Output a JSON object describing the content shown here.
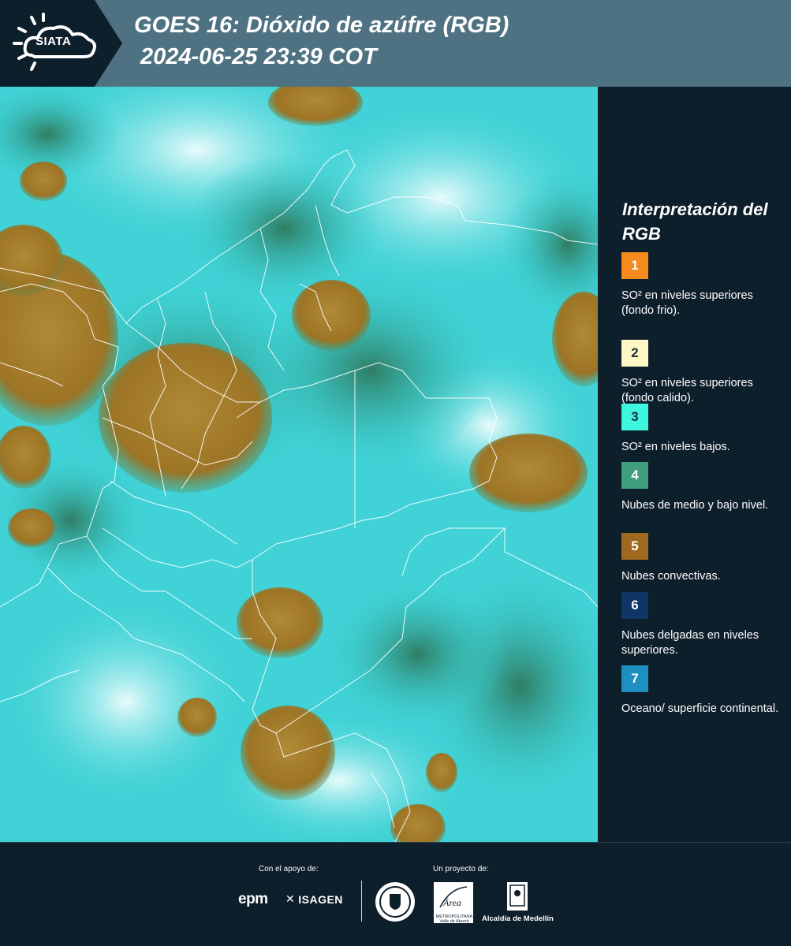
{
  "header": {
    "logo_text": "SIATA",
    "title_line1": "GOES 16: Dióxido de azúfre (RGB)",
    "title_line2": "2024-06-25 23:39 COT"
  },
  "legend": {
    "title": "Interpretación del RGB",
    "items": [
      {
        "number": "1",
        "color": "#f78a1c",
        "text_color": "#ffffff",
        "description": "SO² en niveles superiores (fondo frio)."
      },
      {
        "number": "2",
        "color": "#fdf7c4",
        "text_color": "#1d2d3a",
        "description": "SO² en niveles superiores (fondo calido)."
      },
      {
        "number": "3",
        "color": "#3ef5dd",
        "text_color": "#1d2d3a",
        "description": "SO² en niveles bajos."
      },
      {
        "number": "4",
        "color": "#3f9e7e",
        "text_color": "#ffffff",
        "description": "Nubes de medio y bajo nivel."
      },
      {
        "number": "5",
        "color": "#9f6a1f",
        "text_color": "#ffffff",
        "description": "Nubes convectivas."
      },
      {
        "number": "6",
        "color": "#0f3566",
        "text_color": "#ffffff",
        "description": "Nubes delgadas en niveles superiores."
      },
      {
        "number": "7",
        "color": "#1f8fc2",
        "text_color": "#ffffff",
        "description": "Oceano/ superficie continental."
      }
    ]
  },
  "footer": {
    "support_label": "Con el apoyo de:",
    "project_label": "Un proyecto de:",
    "sponsors": [
      "epm",
      "ISAGEN"
    ],
    "partners": [
      "Área Metropolitana Valle de Aburrá",
      "Alcaldía de Medellín"
    ],
    "alcaldia_text": "Alcaldía de Medellín",
    "area_text": "METROPOLITANA Valle de Aburrá"
  },
  "colors": {
    "header_bg": "#4f7282",
    "panel_bg": "#0e1f2c",
    "map_surface": "#3bd3d6",
    "convective_cloud": "#a07a2a",
    "mid_cloud": "#3f9e7e"
  }
}
